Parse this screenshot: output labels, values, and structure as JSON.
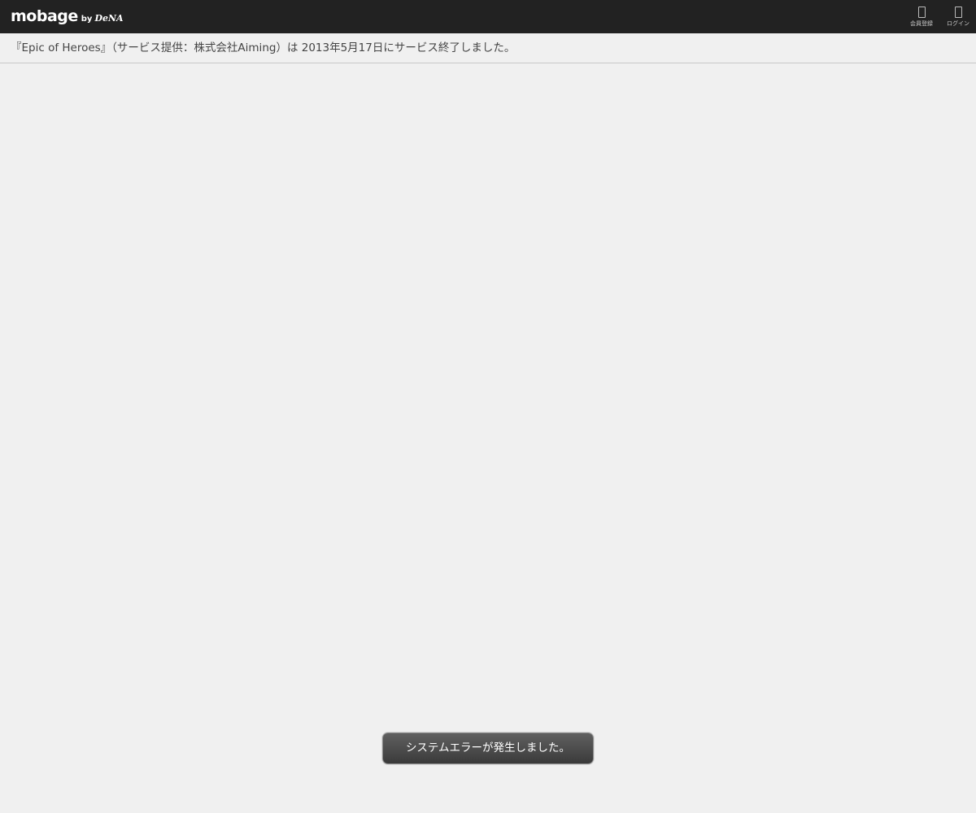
{
  "header": {
    "logo": {
      "main": "mobage",
      "by": "by",
      "brand": "DeNA"
    },
    "nav": [
      {
        "label": "会員登録",
        "icon": "phone-icon"
      },
      {
        "label": "ログイン",
        "icon": "phone-icon"
      }
    ]
  },
  "notice": {
    "text": "『Epic of Heroes』（サービス提供：株式会社Aiming）は 2013年5月17日にサービス終了しました。"
  },
  "toast": {
    "message": "システムエラーが発生しました。"
  },
  "colors": {
    "topbar": "#222222",
    "background": "#f0f0f0",
    "text": "#444444",
    "toast_bg": "#4a4a4a"
  }
}
